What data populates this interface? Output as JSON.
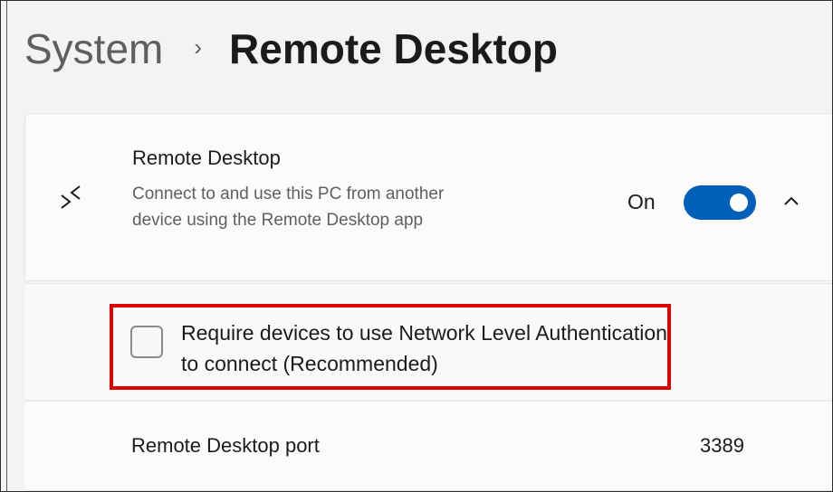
{
  "breadcrumb": {
    "parent": "System",
    "separator": "›",
    "current": "Remote Desktop"
  },
  "remote_desktop": {
    "icon": "remote-desktop-icon",
    "title": "Remote Desktop",
    "description": "Connect to and use this PC from another device using the Remote Desktop app",
    "toggle_label": "On",
    "toggle_on": true,
    "expanded": true
  },
  "nla": {
    "label": "Require devices to use Network Level Authentication to connect (Recommended)",
    "checked": false,
    "highlight_color": "#e00000"
  },
  "port": {
    "label": "Remote Desktop port",
    "value": "3389"
  },
  "colors": {
    "accent": "#005fb8",
    "background": "#f3f3f3",
    "card": "#fbfbfb"
  }
}
